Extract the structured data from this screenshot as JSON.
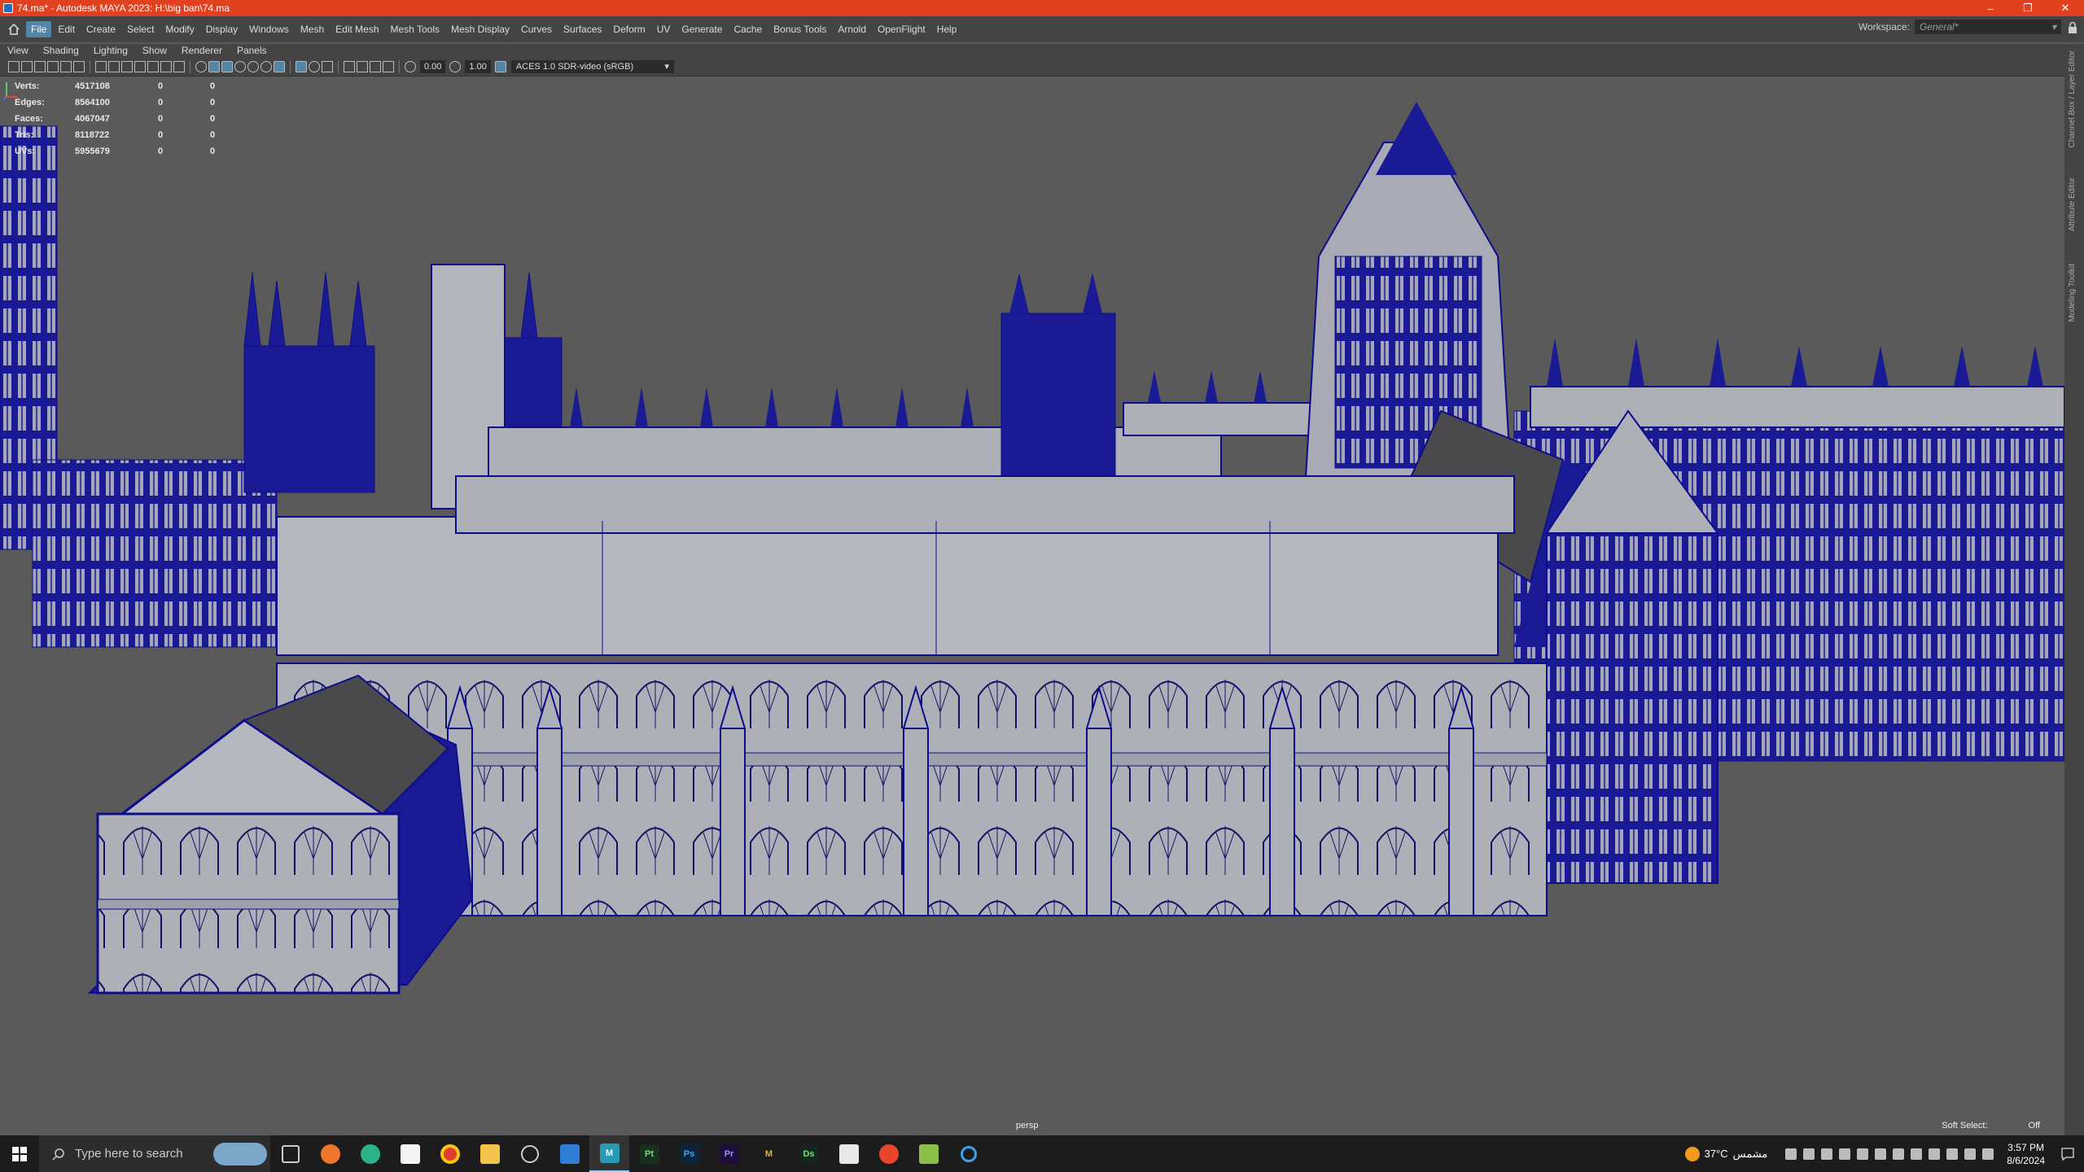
{
  "window": {
    "title": "74.ma* - Autodesk MAYA 2023: H:\\big ban\\74.ma",
    "minimize_icon": "–",
    "maximize_icon": "❐",
    "close_icon": "✕"
  },
  "menubar": {
    "items": [
      "File",
      "Edit",
      "Create",
      "Select",
      "Modify",
      "Display",
      "Windows",
      "Mesh",
      "Edit Mesh",
      "Mesh Tools",
      "Mesh Display",
      "Curves",
      "Surfaces",
      "Deform",
      "UV",
      "Generate",
      "Cache",
      "Bonus Tools",
      "Arnold",
      "OpenFlight",
      "Help"
    ],
    "active": "File",
    "workspace_label": "Workspace:",
    "workspace_value": "General*"
  },
  "panel_menu": {
    "items": [
      "View",
      "Shading",
      "Lighting",
      "Show",
      "Renderer",
      "Panels"
    ]
  },
  "panel_toolbar": {
    "exposure": "0.00",
    "gamma": "1.00",
    "color_space": "ACES 1.0 SDR-video (sRGB)"
  },
  "hud": {
    "rows": [
      {
        "label": "Verts:",
        "v1": "4517108",
        "v2": "0",
        "v3": "0"
      },
      {
        "label": "Edges:",
        "v1": "8564100",
        "v2": "0",
        "v3": "0"
      },
      {
        "label": "Faces:",
        "v1": "4067047",
        "v2": "0",
        "v3": "0"
      },
      {
        "label": "Tris:",
        "v1": "8118722",
        "v2": "0",
        "v3": "0"
      },
      {
        "label": "UVs:",
        "v1": "5955679",
        "v2": "0",
        "v3": "0"
      }
    ]
  },
  "viewport": {
    "camera": "persp",
    "soft_select_label": "Soft Select:",
    "soft_select_value": "Off",
    "wire_color": "#0d0d8a",
    "shade_color": "#b9b9bd"
  },
  "right_strip": {
    "tabs": [
      "Channel Box / Layer Editor",
      "Attribute Editor",
      "Modeling Toolkit"
    ]
  },
  "taskbar": {
    "search_placeholder": "Type here to search",
    "apps": [
      {
        "name": "task-view",
        "label": ""
      },
      {
        "name": "firefox",
        "label": ""
      },
      {
        "name": "edge",
        "label": ""
      },
      {
        "name": "store",
        "label": ""
      },
      {
        "name": "chrome",
        "label": ""
      },
      {
        "name": "file-explorer",
        "label": ""
      },
      {
        "name": "search-app",
        "label": ""
      },
      {
        "name": "blue-app",
        "label": ""
      },
      {
        "name": "maya",
        "label": "M"
      },
      {
        "name": "substance-painter",
        "label": "Pt"
      },
      {
        "name": "photoshop",
        "label": "Ps"
      },
      {
        "name": "premiere",
        "label": "Pr"
      },
      {
        "name": "mudbox",
        "label": "M"
      },
      {
        "name": "substance-designer",
        "label": "Ds"
      },
      {
        "name": "app-14",
        "label": ""
      },
      {
        "name": "app-15",
        "label": ""
      },
      {
        "name": "app-16",
        "label": ""
      },
      {
        "name": "app-17",
        "label": ""
      }
    ],
    "weather_temp": "37°C",
    "weather_text": "مشمس",
    "time": "3:57 PM",
    "date": "8/6/2024"
  }
}
